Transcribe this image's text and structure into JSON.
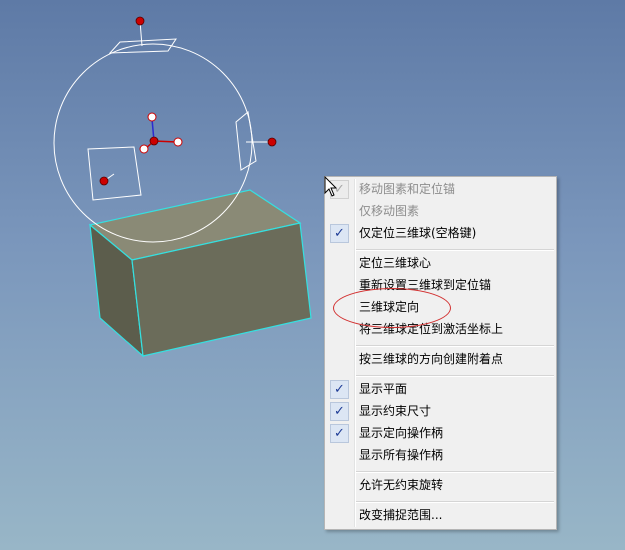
{
  "menu": {
    "items": [
      {
        "label": "移动图素和定位锚",
        "disabled": true,
        "checked": true
      },
      {
        "label": "仅移动图素",
        "disabled": true,
        "checked": false
      },
      {
        "label": "仅定位三维球(空格键)",
        "disabled": false,
        "checked": true
      },
      {
        "label": "定位三维球心",
        "disabled": false,
        "checked": false
      },
      {
        "label": "重新设置三维球到定位锚",
        "disabled": false,
        "checked": false
      },
      {
        "label": "三维球定向",
        "disabled": false,
        "checked": false
      },
      {
        "label": "将三维球定位到激活坐标上",
        "disabled": false,
        "checked": false
      },
      {
        "label": "按三维球的方向创建附着点",
        "disabled": false,
        "checked": false
      },
      {
        "label": "显示平面",
        "disabled": false,
        "checked": true
      },
      {
        "label": "显示约束尺寸",
        "disabled": false,
        "checked": true
      },
      {
        "label": "显示定向操作柄",
        "disabled": false,
        "checked": true
      },
      {
        "label": "显示所有操作柄",
        "disabled": false,
        "checked": false
      },
      {
        "label": "允许无约束旋转",
        "disabled": false,
        "checked": false
      },
      {
        "label": "改变捕捉范围...",
        "disabled": false,
        "checked": false
      }
    ],
    "check_glyph": "✓",
    "highlighted_item": "三维球定向"
  },
  "colors": {
    "background_top": "#5e7aa6",
    "background_bottom": "#98b6c7",
    "box_face": "#6b6c5a",
    "box_top": "#8a8a76",
    "box_edge": "#35e0e0",
    "handle_red": "#cc0000",
    "axis_blue": "#2a2ad0",
    "highlight_ellipse": "#d23030"
  },
  "icons": [
    "check-icon",
    "mouse-cursor-icon",
    "sphere-handle-icon"
  ]
}
